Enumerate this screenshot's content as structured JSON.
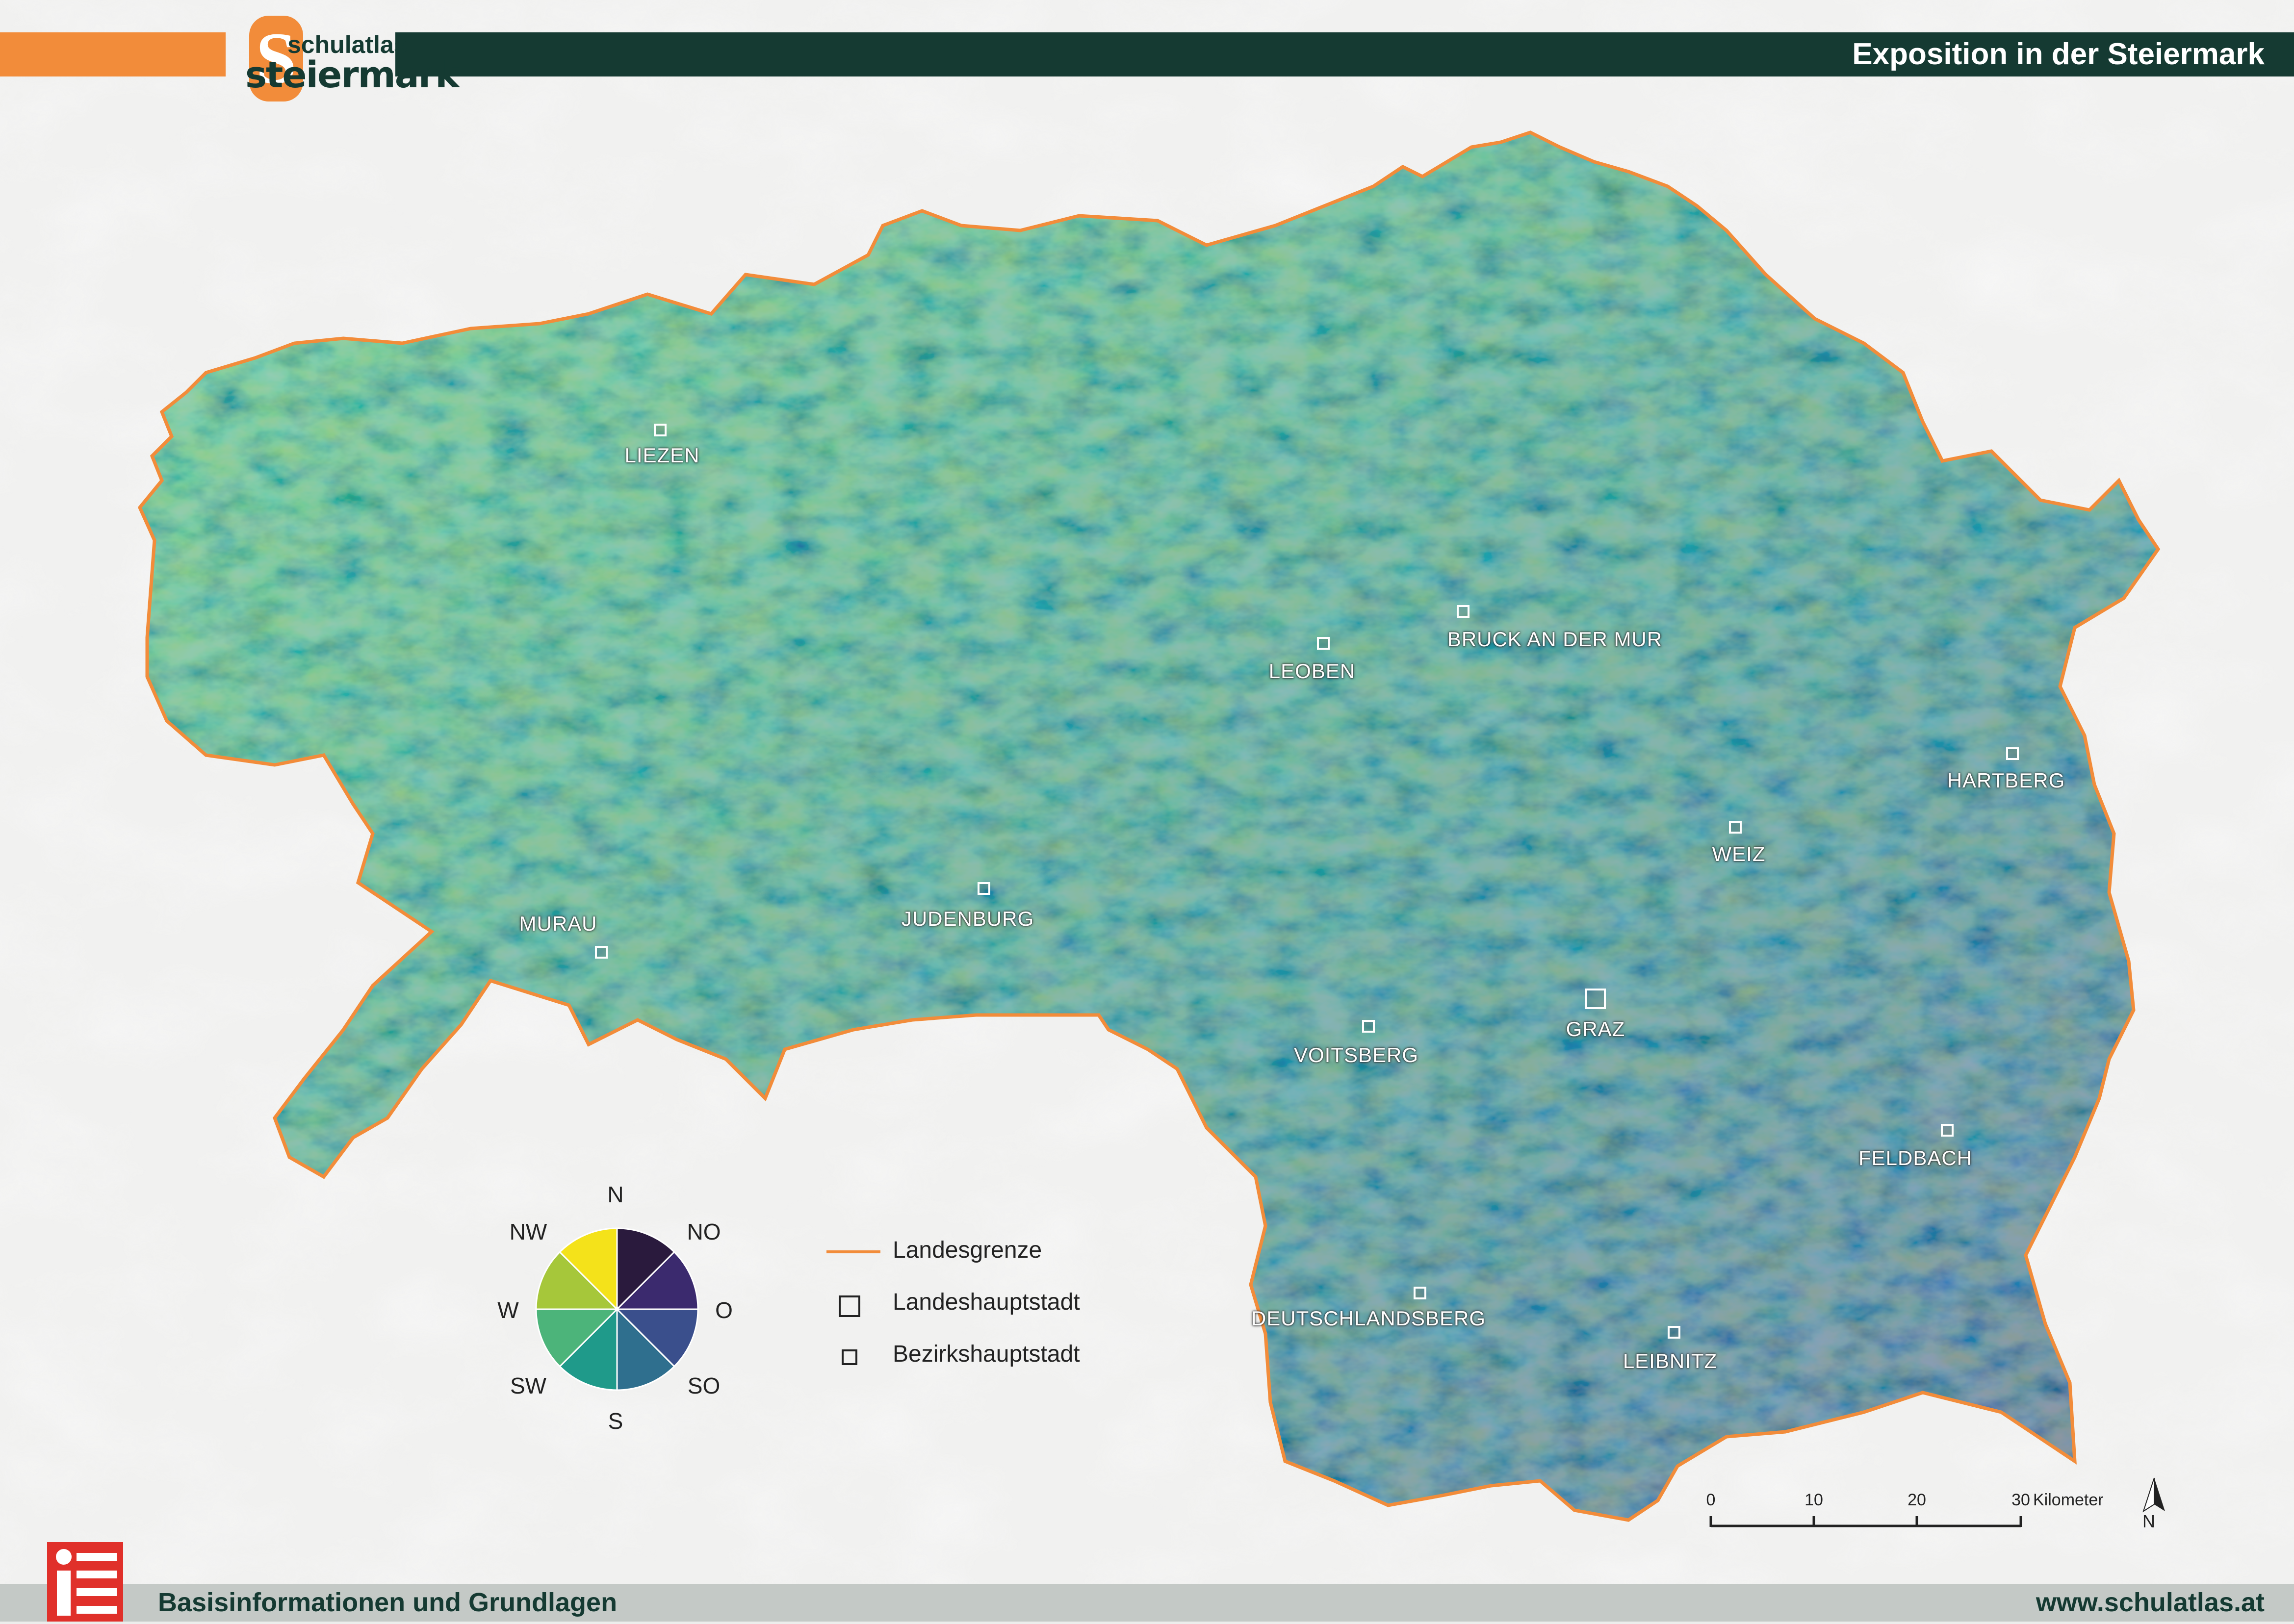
{
  "header": {
    "title": "Exposition in der Steiermark",
    "logo_small": "schulatlas",
    "logo_big": "steiermark",
    "logo_letter": "S",
    "accent_color": "#f28c3a",
    "dark_color": "#153a32"
  },
  "cities": [
    {
      "name": "LIEZEN",
      "type": "Bezirkshauptstadt"
    },
    {
      "name": "LEOBEN",
      "type": "Bezirkshauptstadt"
    },
    {
      "name": "BRUCK AN DER MUR",
      "type": "Bezirkshauptstadt"
    },
    {
      "name": "HARTBERG",
      "type": "Bezirkshauptstadt"
    },
    {
      "name": "WEIZ",
      "type": "Bezirkshauptstadt"
    },
    {
      "name": "MURAU",
      "type": "Bezirkshauptstadt"
    },
    {
      "name": "JUDENBURG",
      "type": "Bezirkshauptstadt"
    },
    {
      "name": "VOITSBERG",
      "type": "Bezirkshauptstadt"
    },
    {
      "name": "GRAZ",
      "type": "Landeshauptstadt"
    },
    {
      "name": "FELDBACH",
      "type": "Bezirkshauptstadt"
    },
    {
      "name": "DEUTSCHLANDSBERG",
      "type": "Bezirkshauptstadt"
    },
    {
      "name": "LEIBNITZ",
      "type": "Bezirkshauptstadt"
    }
  ],
  "wind_rose": {
    "directions": [
      {
        "label": "N",
        "color": "#2a1a3d"
      },
      {
        "label": "NO",
        "color": "#3b2a6e"
      },
      {
        "label": "O",
        "color": "#3a4f8c"
      },
      {
        "label": "SO",
        "color": "#2f6f8e"
      },
      {
        "label": "S",
        "color": "#1f9a8a"
      },
      {
        "label": "SW",
        "color": "#4cb47a"
      },
      {
        "label": "W",
        "color": "#a6c73a"
      },
      {
        "label": "NW",
        "color": "#f4e21a"
      }
    ]
  },
  "legend": {
    "border_label": "Landesgrenze",
    "capital_label": "Landeshauptstadt",
    "district_label": "Bezirkshauptstadt"
  },
  "scale": {
    "ticks": [
      "0",
      "10",
      "20",
      "30"
    ],
    "unit": "Kilometer"
  },
  "north_label": "N",
  "footer": {
    "left": "Basisinformationen und Grundlagen",
    "right": "www.schulatlas.at"
  }
}
